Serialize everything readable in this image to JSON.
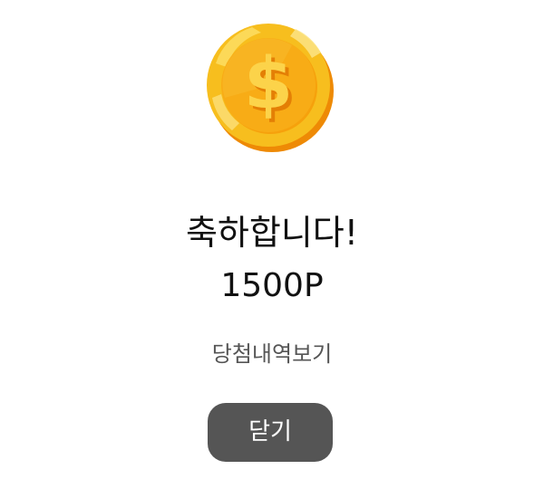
{
  "modal": {
    "coin_icon": "dollar-coin-icon",
    "title": "축하합니다!",
    "points": "1500P",
    "history_link_label": "당첨내역보기",
    "close_label": "닫기"
  },
  "colors": {
    "coin_gold": "#F7BE1E",
    "coin_inner": "#F6A10C",
    "coin_shadow": "#EE8A05",
    "text_primary": "#111111",
    "link_gray": "#555555",
    "button_bg": "#555555",
    "button_text": "#FFFFFF"
  }
}
